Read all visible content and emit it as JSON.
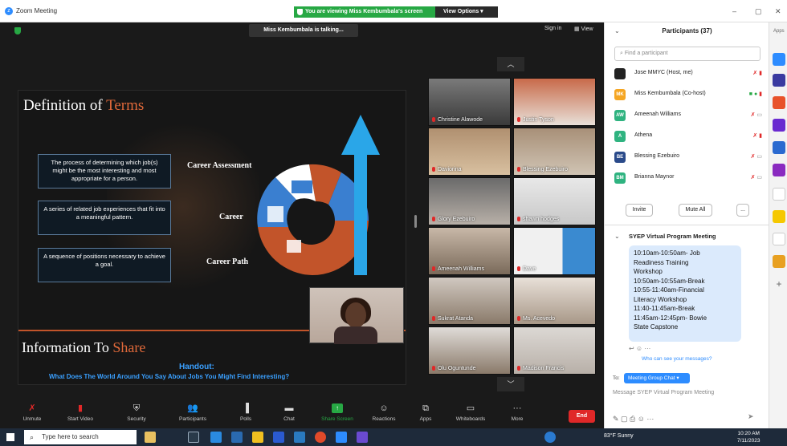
{
  "window": {
    "app_title": "Zoom Meeting",
    "share_banner": "You are viewing Miss Kembumbala's screen",
    "view_options": "View Options",
    "minimize": "–",
    "restore": "▢",
    "close": "✕"
  },
  "meeting": {
    "talking": "Miss Kembumbala is talking...",
    "sign_in": "Sign in",
    "view": "View"
  },
  "slide": {
    "title_main": "Definition of ",
    "title_accent": "Terms",
    "definitions": [
      {
        "text": "The process of determining which job(s) might be the most interesting and most appropriate for a person.",
        "term": "Career Assessment"
      },
      {
        "text": "A series of related job experiences that fit into a meaningful pattern.",
        "term": "Career"
      },
      {
        "text": "A sequence of positions necessary to achieve a goal.",
        "term": "Career Path"
      }
    ],
    "info_main": "Information To ",
    "info_accent": "Share",
    "handout": "Handout:",
    "handout_question": "What Does The World Around You Say About Jobs You Might Find Interesting?"
  },
  "gallery": {
    "tiles": [
      {
        "name": "Christine Alawode"
      },
      {
        "name": "Justin Tyson"
      },
      {
        "name": "Daviorina"
      },
      {
        "name": "Blessing Ezebuiro"
      },
      {
        "name": "Glory Ezebuiro"
      },
      {
        "name": "shawn hodges"
      },
      {
        "name": "Ameenah Williams"
      },
      {
        "name": "Dave"
      },
      {
        "name": "Sukrat Atanda"
      },
      {
        "name": "Ms. Acevedo"
      },
      {
        "name": "Olu Oguntunde"
      },
      {
        "name": "Madison Francis"
      }
    ]
  },
  "toolbar": {
    "unmute": "Unmute",
    "start_video": "Start Video",
    "security": "Security",
    "participants": "Participants",
    "participants_count": "37",
    "polls": "Polls",
    "chat": "Chat",
    "share_screen": "Share Screen",
    "reactions": "Reactions",
    "apps": "Apps",
    "whiteboards": "Whiteboards",
    "more": "More",
    "end": "End"
  },
  "participants_panel": {
    "title": "Participants (37)",
    "search_placeholder": "Find a participant",
    "list": [
      {
        "initials": "",
        "name": "Jose MMYC (Host, me)",
        "color": "#222222"
      },
      {
        "initials": "MK",
        "name": "Miss Kembumbala (Co-host)",
        "color": "#f5a623"
      },
      {
        "initials": "AW",
        "name": "Ameenah Williams",
        "color": "#2fb380"
      },
      {
        "initials": "A",
        "name": "Athena",
        "color": "#2fb380"
      },
      {
        "initials": "BE",
        "name": "Blessing Ezebuiro",
        "color": "#2a4a8a"
      },
      {
        "initials": "BM",
        "name": "Brianna Maynor",
        "color": "#2fb380"
      }
    ],
    "invite": "Invite",
    "mute_all": "Mute All",
    "more": "..."
  },
  "chat_panel": {
    "title": "SYEP Virtual Program Meeting",
    "message_lines": [
      "10:10am-10:50am- Job",
      "Readiness Training",
      "Workshop",
      "10:50am-10:55am-Break",
      "10:55-11:40am-Financial",
      "Literacy Workshop",
      "11:40-11:45am-Break",
      "11:45am-12:45pm- Bowie",
      "State Capstone"
    ],
    "who_can_see": "Who can see your messages?",
    "to_label": "To:",
    "to_value": "Meeting Group Chat",
    "input_placeholder": "Message SYEP Virtual Program Meeting"
  },
  "apps_sidebar": {
    "label": "Apps"
  },
  "taskbar": {
    "search": "Type here to search",
    "weather": "83°F  Sunny",
    "time": "10:20 AM",
    "date": "7/11/2023"
  },
  "colors": {
    "accent_orange": "#e0693a",
    "zoom_blue": "#2d8cff",
    "share_green": "#27a844",
    "end_red": "#e02828"
  }
}
